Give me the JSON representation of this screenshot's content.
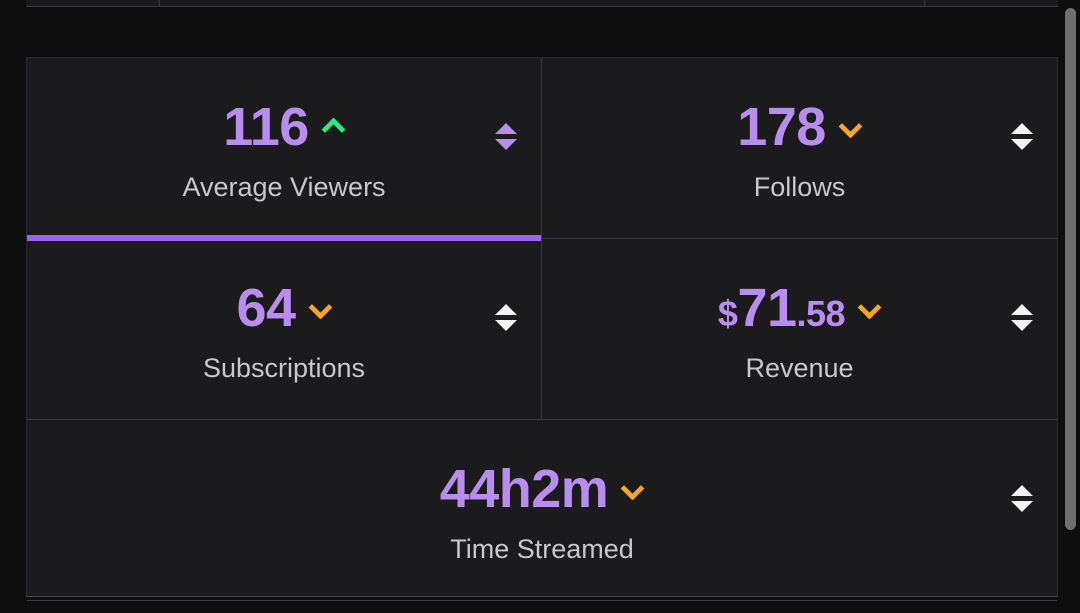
{
  "theme": {
    "page_background": "#0d0d0d",
    "card_background": "#1b1b1d",
    "value_color": "#b98dee",
    "label_color": "#c8c8cc",
    "accent_bar_color": "#a063f0",
    "trend_up_color": "#2ee884",
    "trend_down_color": "#f5a623",
    "divider_color": "#3a3a3e",
    "scrollbar_color": "#6e6e6e"
  },
  "stats": {
    "average_viewers": {
      "value": "116",
      "label": "Average Viewers",
      "trend": "up",
      "trend_icon": "chevron-up-icon",
      "sort_icon": "sort-updown-icon",
      "sort_active": true,
      "active": true
    },
    "follows": {
      "value": "178",
      "label": "Follows",
      "trend": "down",
      "trend_icon": "chevron-down-icon",
      "sort_icon": "sort-updown-icon",
      "sort_active": false,
      "active": false
    },
    "subscriptions": {
      "value": "64",
      "label": "Subscriptions",
      "trend": "down",
      "trend_icon": "chevron-down-icon",
      "sort_icon": "sort-updown-icon",
      "sort_active": false,
      "active": false
    },
    "revenue": {
      "currency_symbol": "$",
      "value_integer": "71",
      "value_decimal": ".58",
      "value": "$71.58",
      "label": "Revenue",
      "trend": "down",
      "trend_icon": "chevron-down-icon",
      "sort_icon": "sort-updown-icon",
      "sort_active": false,
      "active": false
    },
    "time_streamed": {
      "value": "44h2m",
      "label": "Time Streamed",
      "trend": "down",
      "trend_icon": "chevron-down-icon",
      "sort_icon": "sort-updown-icon",
      "sort_active": false,
      "active": false
    }
  },
  "scrollbar": {
    "icon": "scrollbar-thumb-icon",
    "orientation": "vertical"
  }
}
